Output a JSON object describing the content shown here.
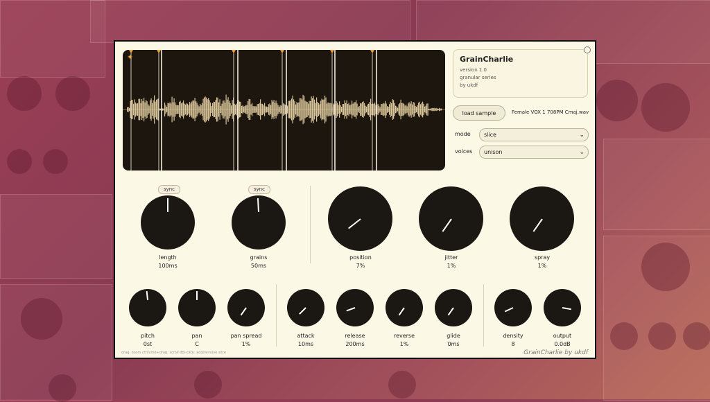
{
  "info": {
    "title": "GrainCharlie",
    "version": "version 1.0",
    "series": "granular series",
    "author": "by ukdf"
  },
  "sample": {
    "load_label": "load sample",
    "filename": "Female VOX 1 708PM Cmaj.wav"
  },
  "mode": {
    "label": "mode",
    "value": "slice"
  },
  "voices": {
    "label": "voices",
    "value": "unison"
  },
  "knobs": {
    "length": {
      "label": "length",
      "value": "100ms",
      "sync": "sync"
    },
    "grains": {
      "label": "grains",
      "value": "50ms",
      "sync": "sync"
    },
    "position": {
      "label": "position",
      "value": "7%"
    },
    "jitter": {
      "label": "jitter",
      "value": "1%"
    },
    "spray": {
      "label": "spray",
      "value": "1%"
    },
    "pitch": {
      "label": "pitch",
      "value": "0st"
    },
    "pan": {
      "label": "pan",
      "value": "C"
    },
    "pan_spread": {
      "label": "pan spread",
      "value": "1%"
    },
    "attack": {
      "label": "attack",
      "value": "10ms"
    },
    "release": {
      "label": "release",
      "value": "200ms"
    },
    "reverse": {
      "label": "reverse",
      "value": "1%"
    },
    "glide": {
      "label": "glide",
      "value": "0ms"
    },
    "density": {
      "label": "density",
      "value": "8"
    },
    "output": {
      "label": "output",
      "value": "0.0dB"
    }
  },
  "hint": "drag: zoom   ctrl/cmd+drag: scroll   dbl-click: add/remove slice",
  "signature": "GrainCharlie by ukdf",
  "colors": {
    "accent": "#f0a030",
    "wave": "#d9c59a",
    "knob": "#1b1712",
    "panel": "#fbf8e6"
  }
}
